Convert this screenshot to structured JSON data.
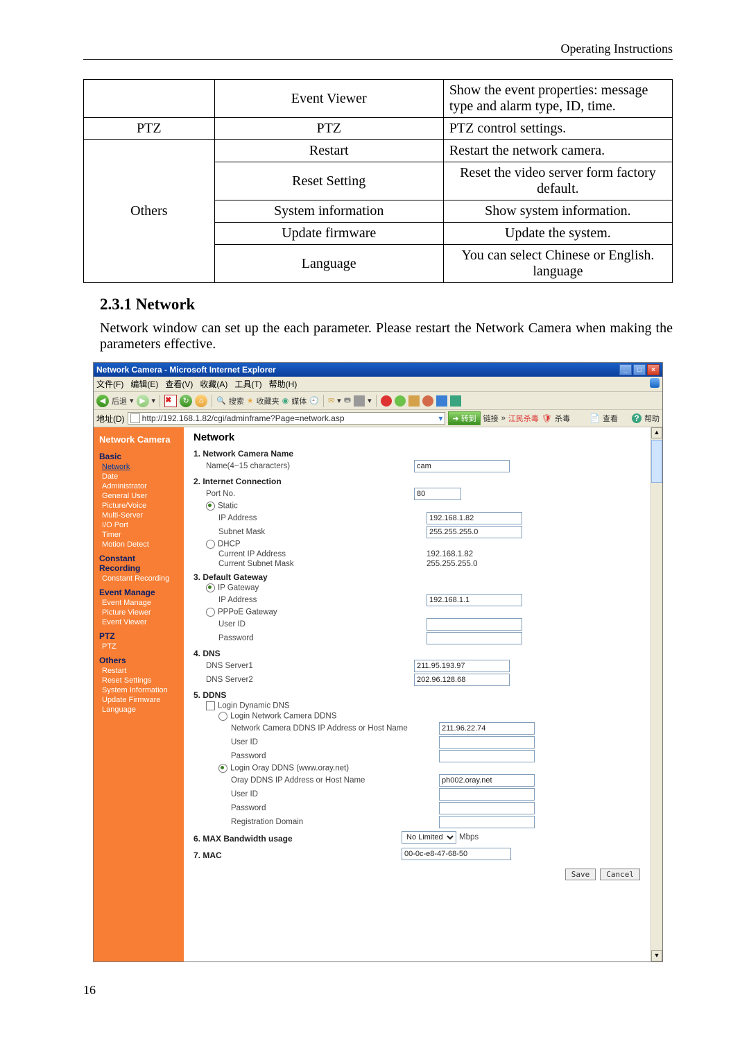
{
  "header_right": "Operating Instructions",
  "page_number": "16",
  "table": {
    "rows": [
      {
        "c1": "",
        "c2": "Event Viewer",
        "c3_html": "Show the event properties: message type and alarm type, ID, time."
      },
      {
        "c1": "PTZ",
        "c2": "PTZ",
        "c3": "PTZ control settings."
      },
      {
        "c1": "",
        "c2": "Restart",
        "c3": "Restart the network camera."
      },
      {
        "c1": "",
        "c2": "Reset Setting",
        "c3": "Reset the video server form factory default."
      },
      {
        "c1": "Others",
        "c2": "System information",
        "c3": "Show system information."
      },
      {
        "c1": "",
        "c2": "Update firmware",
        "c3": "Update the system."
      },
      {
        "c1": "",
        "c2": "Language",
        "c3": "You can select Chinese or English. language"
      }
    ]
  },
  "section_heading": "2.3.1 Network",
  "section_body": "Network window can set up the each parameter. Please restart the Network Camera when making the parameters effective.",
  "shot": {
    "title": "Network Camera - Microsoft Internet Explorer",
    "menu": [
      "文件(F)",
      "编辑(E)",
      "查看(V)",
      "收藏(A)",
      "工具(T)",
      "帮助(H)"
    ],
    "toolbar": {
      "back": "后退",
      "search": "搜索",
      "fav": "收藏夹",
      "media": "媒体"
    },
    "addr_label": "地址(D)",
    "addr_url": "http://192.168.1.82/cgi/adminframe?Page=network.asp",
    "go": "转到",
    "links": "链接",
    "blocked": "江民杀毒",
    "flood": "杀毒",
    "settings_btn": "查看",
    "help_btn": "帮助",
    "sidebar": {
      "title": "Network Camera",
      "groups": [
        {
          "head": "Basic",
          "items": [
            "Network",
            "Date",
            "Administrator",
            "General User",
            "Picture/Voice",
            "Multi-Server",
            "I/O Port",
            "Timer",
            "Motion Detect"
          ]
        },
        {
          "head": "Constant Recording",
          "items": [
            "Constant Recording"
          ]
        },
        {
          "head": "Event Manage",
          "items": [
            "Event Manage",
            "Picture Viewer",
            "Event Viewer"
          ]
        },
        {
          "head": "PTZ",
          "items": [
            "PTZ"
          ]
        },
        {
          "head": "Others",
          "items": [
            "Restart",
            "Reset Settings",
            "System Information",
            "Update Firmware",
            "Language"
          ]
        }
      ]
    },
    "main": {
      "title": "Network",
      "h1": "1. Network Camera Name",
      "name_label": "Name(4~15 characters)",
      "name_val": "cam",
      "h2": "2. Internet Connection",
      "port_label": "Port No.",
      "port_val": "80",
      "static": "Static",
      "ip_label": "IP Address",
      "ip_val": "192.168.1.82",
      "mask_label": "Subnet Mask",
      "mask_val": "255.255.255.0",
      "dhcp": "DHCP",
      "cur_ip_label": "Current IP Address",
      "cur_ip_val": "192.168.1.82",
      "cur_mask_label": "Current Subnet Mask",
      "cur_mask_val": "255.255.255.0",
      "h3": "3. Default Gateway",
      "ipgw": "IP Gateway",
      "gw_ip_label": "IP Address",
      "gw_ip_val": "192.168.1.1",
      "pppoe": "PPPoE Gateway",
      "user_id": "User ID",
      "password": "Password",
      "h4": "4. DNS",
      "dns1_label": "DNS Server1",
      "dns1_val": "211.95.193.97",
      "dns2_label": "DNS Server2",
      "dns2_val": "202.96.128.68",
      "h5": "5. DDNS",
      "login_ddns": "Login Dynamic DNS",
      "nc_ddns": "Login Network Camera DDNS",
      "nc_ddns_host": "Network Camera DDNS IP Address or Host Name",
      "nc_ddns_host_val": "211.96.22.74",
      "oray": "Login Oray DDNS (www.oray.net)",
      "oray_host": "Oray DDNS IP Address or Host Name",
      "oray_host_val": "ph002.oray.net",
      "reg_domain": "Registration Domain",
      "h6": "6. MAX Bandwidth usage",
      "bw_val": "No Limited",
      "bw_unit": "Mbps",
      "h7": "7. MAC",
      "mac_val": "00-0c-e8-47-68-50",
      "save": "Save",
      "cancel": "Cancel"
    }
  }
}
